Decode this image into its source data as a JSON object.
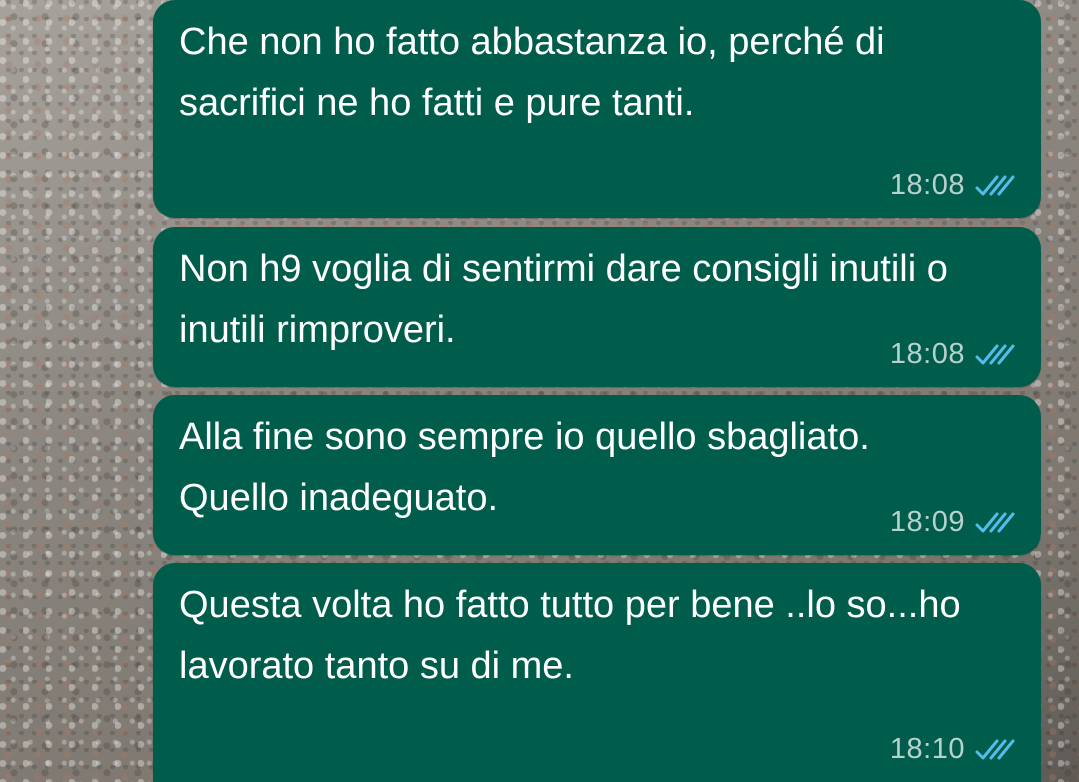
{
  "messages": [
    {
      "text": "Che non ho fatto abbastanza io, perché di sacrifici ne ho fatti e pure tanti.",
      "time": "18:08",
      "status_icon": "double-check-read-icon"
    },
    {
      "text": "Non h9 voglia di sentirmi dare consigli inutili o inutili rimproveri.",
      "time": "18:08",
      "status_icon": "double-check-read-icon"
    },
    {
      "text": "Alla fine sono sempre io quello sbagliato. Quello inadeguato.",
      "time": "18:09",
      "status_icon": "double-check-read-icon"
    },
    {
      "text": "Questa volta ho fatto tutto per bene ..lo so...ho lavorato tanto su di me.",
      "time": "18:10",
      "status_icon": "double-check-read-icon"
    }
  ],
  "colors": {
    "outgoing_bubble": "#005c4b",
    "read_tick": "#53bdeb",
    "text": "#ffffff"
  }
}
